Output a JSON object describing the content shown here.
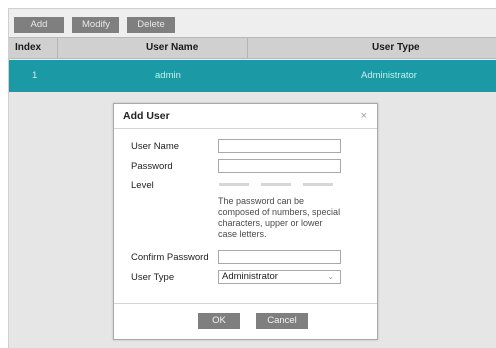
{
  "toolbar": {
    "add": "Add",
    "modify": "Modify",
    "delete": "Delete"
  },
  "table": {
    "headers": {
      "index": "Index",
      "user_name": "User Name",
      "user_type": "User Type"
    },
    "rows": [
      {
        "index": "1",
        "user_name": "admin",
        "user_type": "Administrator"
      }
    ]
  },
  "dialog": {
    "title": "Add User",
    "close": "×",
    "labels": {
      "user_name": "User Name",
      "password": "Password",
      "level": "Level",
      "confirm_password": "Confirm Password",
      "user_type": "User Type"
    },
    "fields": {
      "user_name": "",
      "password": "",
      "confirm_password": ""
    },
    "hint": "The password can be composed of numbers, special characters, upper or lower case letters.",
    "user_type_selected": "Administrator",
    "ok": "OK",
    "cancel": "Cancel"
  },
  "colors": {
    "selected_row": "#1b9aa6",
    "button_bg": "#7f7f7f"
  },
  "icons": {
    "close": "close-icon",
    "dropdown": "chevron-down-icon"
  }
}
